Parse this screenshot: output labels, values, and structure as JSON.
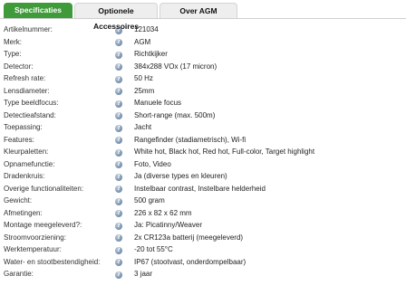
{
  "tabs": [
    {
      "label": "Specificaties",
      "active": true
    },
    {
      "label": "Optionele Accessoires",
      "active": false
    },
    {
      "label": "Over AGM",
      "active": false
    }
  ],
  "colors": {
    "active_tab": "#3f9b3a",
    "info_icon": "#7d95b0"
  },
  "icons": {
    "info": "info-icon"
  },
  "specs": [
    {
      "label": "Artikelnummer:",
      "value": "121034"
    },
    {
      "label": "Merk:",
      "value": "AGM"
    },
    {
      "label": "Type:",
      "value": "Richtkijker"
    },
    {
      "label": "Detector:",
      "value": "384x288 VOx (17 micron)"
    },
    {
      "label": "Refresh rate:",
      "value": "50 Hz"
    },
    {
      "label": "Lensdiameter:",
      "value": "25mm"
    },
    {
      "label": "Type beeldfocus:",
      "value": "Manuele focus"
    },
    {
      "label": "Detectieafstand:",
      "value": "Short-range (max. 500m)"
    },
    {
      "label": "Toepassing:",
      "value": "Jacht"
    },
    {
      "label": "Features:",
      "value": "Rangefinder (stadiametrisch), Wi-fi"
    },
    {
      "label": "Kleurpaletten:",
      "value": "White hot, Black hot, Red hot, Full-color, Target highlight"
    },
    {
      "label": "Opnamefunctie:",
      "value": "Foto, Video"
    },
    {
      "label": "Dradenkruis:",
      "value": "Ja (diverse types en kleuren)"
    },
    {
      "label": "Overige functionaliteiten:",
      "value": "Instelbaar contrast, Instelbare helderheid"
    },
    {
      "label": "Gewicht:",
      "value": "500 gram"
    },
    {
      "label": "Afmetingen:",
      "value": "226 x 82 x 62 mm"
    },
    {
      "label": "Montage meegeleverd?:",
      "value": "Ja: Picatinny/Weaver"
    },
    {
      "label": "Stroomvoorziening:",
      "value": "2x CR123a batterij (meegeleverd)"
    },
    {
      "label": "Werktemperatuur:",
      "value": "-20 tot 55°C"
    },
    {
      "label": "Water- en stootbestendigheid:",
      "value": "IP67 (stootvast, onderdompelbaar)"
    },
    {
      "label": "Garantie:",
      "value": "3 jaar"
    }
  ]
}
